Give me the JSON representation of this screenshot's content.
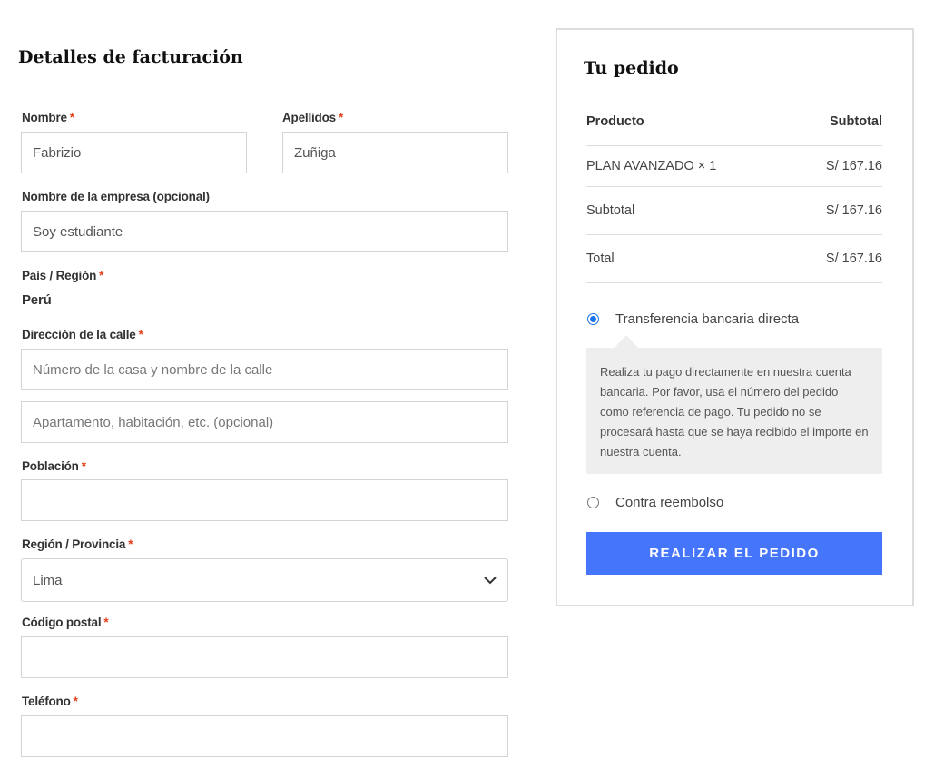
{
  "billing": {
    "title": "Detalles de facturación",
    "required_mark": "*",
    "first_name": {
      "label": "Nombre",
      "value": "Fabrizio"
    },
    "last_name": {
      "label": "Apellidos",
      "value": "Zuñiga"
    },
    "company": {
      "label": "Nombre de la empresa (opcional)",
      "value": "Soy estudiante"
    },
    "country": {
      "label": "País / Región",
      "value": "Perú"
    },
    "street": {
      "label": "Dirección de la calle",
      "placeholder1": "Número de la casa y nombre de la calle",
      "placeholder2": "Apartamento, habitación, etc. (opcional)"
    },
    "city": {
      "label": "Población",
      "value": ""
    },
    "region": {
      "label": "Región / Provincia",
      "value": "Lima"
    },
    "postcode": {
      "label": "Código postal",
      "value": ""
    },
    "phone": {
      "label": "Teléfono",
      "value": ""
    }
  },
  "order": {
    "title": "Tu pedido",
    "col_product": "Producto",
    "col_subtotal": "Subtotal",
    "item_name": "PLAN AVANZADO × 1",
    "item_price": "S/ 167.16",
    "subtotal_label": "Subtotal",
    "subtotal_value": "S/ 167.16",
    "total_label": "Total",
    "total_value": "S/ 167.16",
    "payment1": "Transferencia bancaria directa",
    "payment1_desc": "Realiza tu pago directamente en nuestra cuenta bancaria. Por favor, usa el número del pedido como referencia de pago. Tu pedido no se procesará hasta que se haya recibido el importe en nuestra cuenta.",
    "payment2": "Contra reembolso",
    "place_order": "REALIZAR EL PEDIDO",
    "accent": "#4475fb"
  }
}
